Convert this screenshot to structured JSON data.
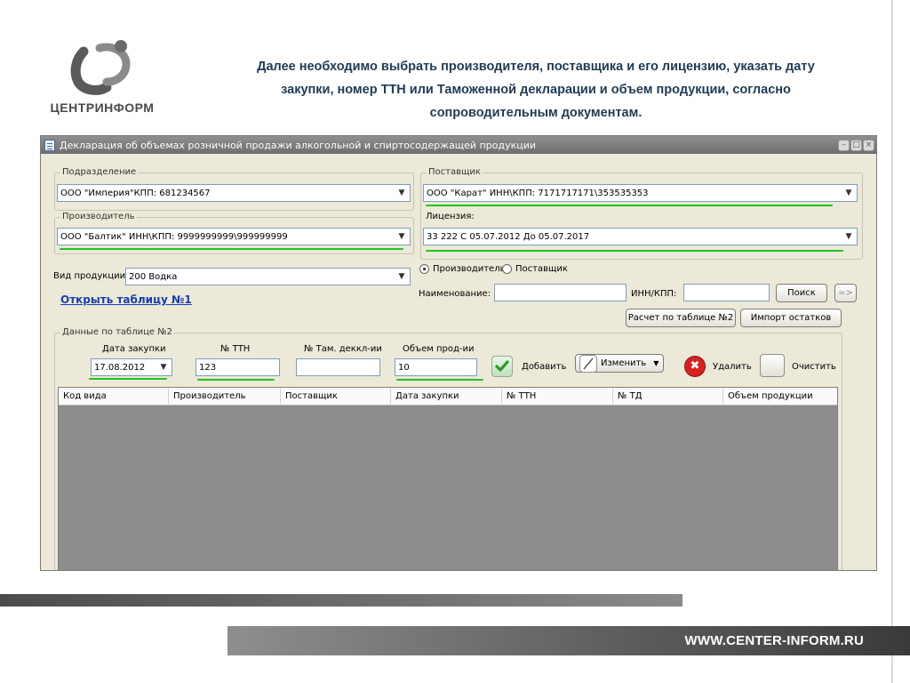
{
  "slide": {
    "logo_text": "ЦЕНТРИНФОРМ",
    "caption_lines": [
      "Далее необходимо выбрать производителя, поставщика и его лицензию, указать дату",
      "закупки, номер ТТН или Таможенной декларации и объем продукции, согласно",
      "сопроводительным документам."
    ],
    "website": "WWW.CENTER-INFORM.RU",
    "colors": {
      "caption": "#1f3b54",
      "highlight": "#22c31f"
    }
  },
  "window": {
    "title": "Декларация об объемах розничной продажи алкогольной и спиртосодержащей продукции",
    "controls": [
      "minimize",
      "maximize",
      "close"
    ]
  },
  "form": {
    "division": {
      "label": "Подразделение",
      "value": "ООО \"Империя\"КПП: 681234567"
    },
    "manufacturer": {
      "label": "Производитель",
      "value": "ООО \"Балтик\"  ИНН\\КПП: 9999999999\\999999999"
    },
    "supplier": {
      "label": "Поставщик",
      "value": "ООО \"Карат\"  ИНН\\КПП:  7171717171\\353535353"
    },
    "license": {
      "label": "Лицензия:",
      "value": "33  222 С 05.07.2012 До 05.07.2017"
    },
    "product_type": {
      "label": "Вид продукции:",
      "value": "200 Водка"
    },
    "open_table_link": "Открыть таблицу №1",
    "radio": {
      "option1": "Производитель",
      "option2": "Поставщик",
      "selected": "option1"
    },
    "name_label": "Наименование:",
    "inn_label": "ИНН/КПП:",
    "search_button": "Поиск",
    "next_button": "=>",
    "calc_button": "Расчет по таблице №2",
    "import_button": "Импорт остатков"
  },
  "table2": {
    "group_label": "Данные по таблице №2",
    "date_label": "Дата закупки",
    "date_value": "17.08.2012",
    "ttn_label": "№ ТТН",
    "ttn_value": "123",
    "customs_label": "№ Там. деккл-ии",
    "customs_value": "",
    "volume_label": "Объем прод-ии",
    "volume_value": "10",
    "add_button": "Добавить",
    "edit_button": "Изменить",
    "delete_button": "Удалить",
    "clear_button": "Очистить",
    "columns": [
      "Код вида",
      "Производитель",
      "Поставщик",
      "Дата закупки",
      "№ ТТН",
      "№ ТД",
      "Объем продукции"
    ]
  }
}
